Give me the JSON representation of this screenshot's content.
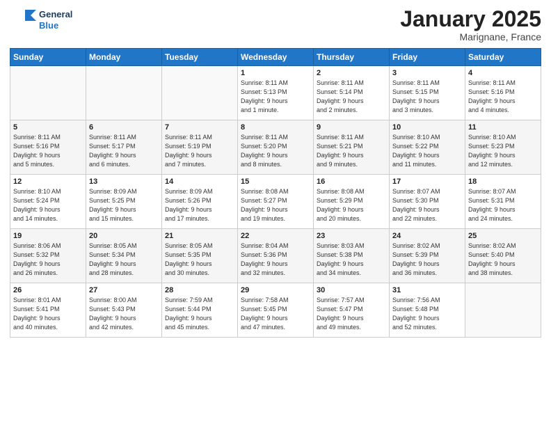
{
  "logo": {
    "line1": "General",
    "line2": "Blue"
  },
  "title": "January 2025",
  "location": "Marignane, France",
  "days_of_week": [
    "Sunday",
    "Monday",
    "Tuesday",
    "Wednesday",
    "Thursday",
    "Friday",
    "Saturday"
  ],
  "weeks": [
    [
      {
        "day": "",
        "text": ""
      },
      {
        "day": "",
        "text": ""
      },
      {
        "day": "",
        "text": ""
      },
      {
        "day": "1",
        "text": "Sunrise: 8:11 AM\nSunset: 5:13 PM\nDaylight: 9 hours\nand 1 minute."
      },
      {
        "day": "2",
        "text": "Sunrise: 8:11 AM\nSunset: 5:14 PM\nDaylight: 9 hours\nand 2 minutes."
      },
      {
        "day": "3",
        "text": "Sunrise: 8:11 AM\nSunset: 5:15 PM\nDaylight: 9 hours\nand 3 minutes."
      },
      {
        "day": "4",
        "text": "Sunrise: 8:11 AM\nSunset: 5:16 PM\nDaylight: 9 hours\nand 4 minutes."
      }
    ],
    [
      {
        "day": "5",
        "text": "Sunrise: 8:11 AM\nSunset: 5:16 PM\nDaylight: 9 hours\nand 5 minutes."
      },
      {
        "day": "6",
        "text": "Sunrise: 8:11 AM\nSunset: 5:17 PM\nDaylight: 9 hours\nand 6 minutes."
      },
      {
        "day": "7",
        "text": "Sunrise: 8:11 AM\nSunset: 5:19 PM\nDaylight: 9 hours\nand 7 minutes."
      },
      {
        "day": "8",
        "text": "Sunrise: 8:11 AM\nSunset: 5:20 PM\nDaylight: 9 hours\nand 8 minutes."
      },
      {
        "day": "9",
        "text": "Sunrise: 8:11 AM\nSunset: 5:21 PM\nDaylight: 9 hours\nand 9 minutes."
      },
      {
        "day": "10",
        "text": "Sunrise: 8:10 AM\nSunset: 5:22 PM\nDaylight: 9 hours\nand 11 minutes."
      },
      {
        "day": "11",
        "text": "Sunrise: 8:10 AM\nSunset: 5:23 PM\nDaylight: 9 hours\nand 12 minutes."
      }
    ],
    [
      {
        "day": "12",
        "text": "Sunrise: 8:10 AM\nSunset: 5:24 PM\nDaylight: 9 hours\nand 14 minutes."
      },
      {
        "day": "13",
        "text": "Sunrise: 8:09 AM\nSunset: 5:25 PM\nDaylight: 9 hours\nand 15 minutes."
      },
      {
        "day": "14",
        "text": "Sunrise: 8:09 AM\nSunset: 5:26 PM\nDaylight: 9 hours\nand 17 minutes."
      },
      {
        "day": "15",
        "text": "Sunrise: 8:08 AM\nSunset: 5:27 PM\nDaylight: 9 hours\nand 19 minutes."
      },
      {
        "day": "16",
        "text": "Sunrise: 8:08 AM\nSunset: 5:29 PM\nDaylight: 9 hours\nand 20 minutes."
      },
      {
        "day": "17",
        "text": "Sunrise: 8:07 AM\nSunset: 5:30 PM\nDaylight: 9 hours\nand 22 minutes."
      },
      {
        "day": "18",
        "text": "Sunrise: 8:07 AM\nSunset: 5:31 PM\nDaylight: 9 hours\nand 24 minutes."
      }
    ],
    [
      {
        "day": "19",
        "text": "Sunrise: 8:06 AM\nSunset: 5:32 PM\nDaylight: 9 hours\nand 26 minutes."
      },
      {
        "day": "20",
        "text": "Sunrise: 8:05 AM\nSunset: 5:34 PM\nDaylight: 9 hours\nand 28 minutes."
      },
      {
        "day": "21",
        "text": "Sunrise: 8:05 AM\nSunset: 5:35 PM\nDaylight: 9 hours\nand 30 minutes."
      },
      {
        "day": "22",
        "text": "Sunrise: 8:04 AM\nSunset: 5:36 PM\nDaylight: 9 hours\nand 32 minutes."
      },
      {
        "day": "23",
        "text": "Sunrise: 8:03 AM\nSunset: 5:38 PM\nDaylight: 9 hours\nand 34 minutes."
      },
      {
        "day": "24",
        "text": "Sunrise: 8:02 AM\nSunset: 5:39 PM\nDaylight: 9 hours\nand 36 minutes."
      },
      {
        "day": "25",
        "text": "Sunrise: 8:02 AM\nSunset: 5:40 PM\nDaylight: 9 hours\nand 38 minutes."
      }
    ],
    [
      {
        "day": "26",
        "text": "Sunrise: 8:01 AM\nSunset: 5:41 PM\nDaylight: 9 hours\nand 40 minutes."
      },
      {
        "day": "27",
        "text": "Sunrise: 8:00 AM\nSunset: 5:43 PM\nDaylight: 9 hours\nand 42 minutes."
      },
      {
        "day": "28",
        "text": "Sunrise: 7:59 AM\nSunset: 5:44 PM\nDaylight: 9 hours\nand 45 minutes."
      },
      {
        "day": "29",
        "text": "Sunrise: 7:58 AM\nSunset: 5:45 PM\nDaylight: 9 hours\nand 47 minutes."
      },
      {
        "day": "30",
        "text": "Sunrise: 7:57 AM\nSunset: 5:47 PM\nDaylight: 9 hours\nand 49 minutes."
      },
      {
        "day": "31",
        "text": "Sunrise: 7:56 AM\nSunset: 5:48 PM\nDaylight: 9 hours\nand 52 minutes."
      },
      {
        "day": "",
        "text": ""
      }
    ]
  ]
}
